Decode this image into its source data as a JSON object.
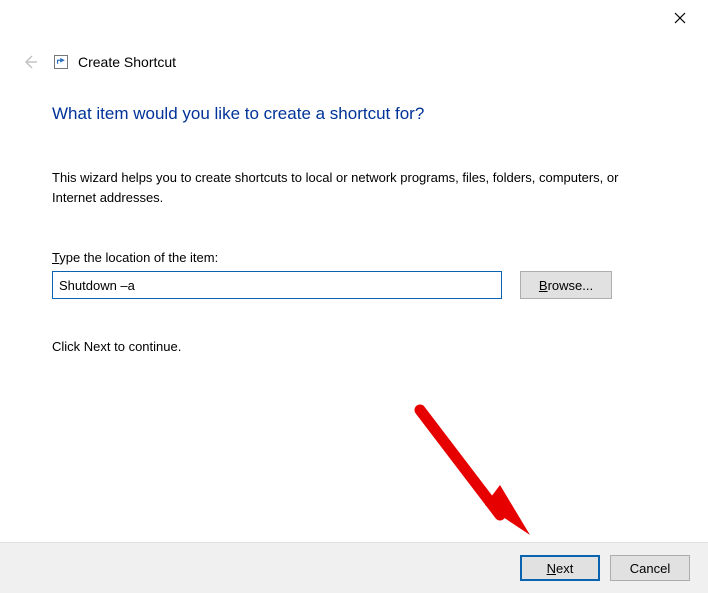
{
  "header": {
    "title": "Create Shortcut"
  },
  "main": {
    "heading": "What item would you like to create a shortcut for?",
    "body": "This wizard helps you to create shortcuts to local or network programs, files, folders, computers, or Internet addresses.",
    "field_label_pre": "T",
    "field_label_rest": "ype the location of the item:",
    "location_value": "Shutdown –a",
    "browse_pre": "B",
    "browse_rest": "rowse...",
    "continue": "Click Next to continue."
  },
  "footer": {
    "next_pre": "N",
    "next_rest": "ext",
    "cancel": "Cancel"
  }
}
